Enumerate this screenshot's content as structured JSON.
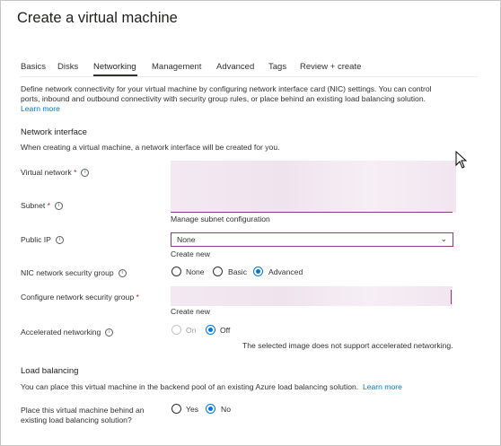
{
  "page": {
    "title": "Create a virtual machine"
  },
  "tabs": [
    {
      "label": "Basics"
    },
    {
      "label": "Disks"
    },
    {
      "label": "Networking"
    },
    {
      "label": "Management"
    },
    {
      "label": "Advanced"
    },
    {
      "label": "Tags"
    },
    {
      "label": "Review + create"
    }
  ],
  "active_tab": "Networking",
  "intro": {
    "text": "Define network connectivity for your virtual machine by configuring network interface card (NIC) settings. You can control ports, inbound and outbound connectivity with security group rules, or place behind an existing load balancing solution.",
    "learn_more": "Learn more"
  },
  "network_interface": {
    "heading": "Network interface",
    "subtext": "When creating a virtual machine, a network interface will be created for you.",
    "virtual_network_label": "Virtual network",
    "subnet_label": "Subnet",
    "manage_subnet_link": "Manage subnet configuration",
    "public_ip_label": "Public IP",
    "public_ip_value": "None",
    "create_new_link": "Create new",
    "nic_nsg_label": "NIC network security group",
    "nic_nsg_options": [
      "None",
      "Basic",
      "Advanced"
    ],
    "nic_nsg_selected": "Advanced",
    "configure_nsg_label": "Configure network security group",
    "configure_nsg_create_new": "Create new",
    "accel_label": "Accelerated networking",
    "accel_options": [
      "On",
      "Off"
    ],
    "accel_selected": "Off",
    "accel_note": "The selected image does not support accelerated networking."
  },
  "load_balancing": {
    "heading": "Load balancing",
    "subtext": "You can place this virtual machine in the backend pool of an existing Azure load balancing solution.",
    "learn_more": "Learn more",
    "question_line1": "Place this virtual machine behind an",
    "question_line2": "existing load balancing solution?",
    "options": [
      "Yes",
      "No"
    ],
    "selected": "No"
  },
  "required_marker": "*"
}
